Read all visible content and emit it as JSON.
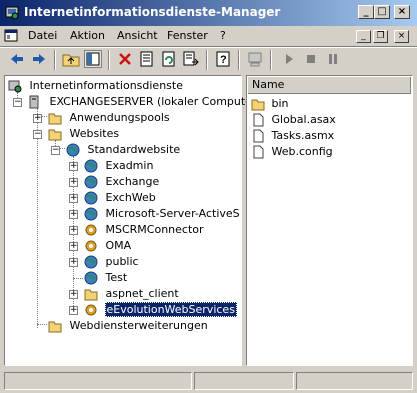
{
  "window": {
    "title": "Internetinformationsdienste-Manager"
  },
  "menu": {
    "items": [
      "Datei",
      "Aktion",
      "Ansicht",
      "Fenster",
      "?"
    ]
  },
  "toolbar": {
    "icons": [
      "back-arrow-icon",
      "forward-arrow-icon",
      "up-folder-icon",
      "show-hide-tree-icon",
      "delete-icon",
      "properties-icon",
      "refresh-icon",
      "export-list-icon",
      "help-icon",
      "computer-icon",
      "play-icon",
      "stop-icon",
      "pause-icon"
    ]
  },
  "tree": {
    "root": "Internetinformationsdienste",
    "server": "EXCHANGESERVER (lokaler Computer)",
    "app_pools": "Anwendungspools",
    "websites": "Websites",
    "default_site": "Standardwebsite",
    "children": [
      "Exadmin",
      "Exchange",
      "ExchWeb",
      "Microsoft-Server-ActiveSync",
      "MSCRMConnector",
      "OMA",
      "public",
      "Test",
      "aspnet_client",
      "eEvolutionWebServices"
    ],
    "selected": "eEvolutionWebServices",
    "extensions": "Webdiensterweiterungen"
  },
  "list": {
    "header": "Name",
    "items": [
      {
        "name": "bin",
        "icon": "folder-icon"
      },
      {
        "name": "Global.asax",
        "icon": "file-icon"
      },
      {
        "name": "Tasks.asmx",
        "icon": "file-icon"
      },
      {
        "name": "Web.config",
        "icon": "file-icon"
      }
    ]
  },
  "colors": {
    "titlebar_start": "#0a246a",
    "titlebar_end": "#a6caf0",
    "selection": "#0a246a",
    "face": "#d4d0c8"
  }
}
